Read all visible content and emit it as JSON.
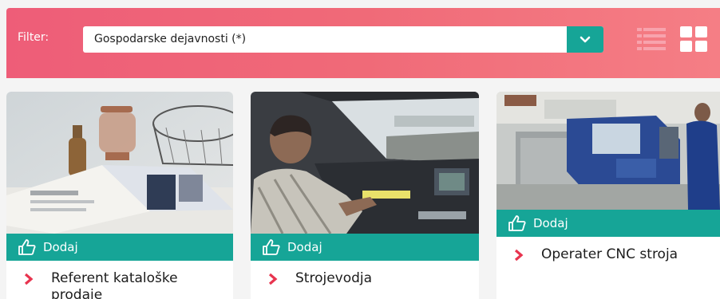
{
  "filter": {
    "label": "Filter:",
    "selected_value": "Gospodarske dejavnosti (*)",
    "toggle_icon": "chevron-down-icon"
  },
  "view_options": [
    {
      "icon": "list-view-icon",
      "active": false
    },
    {
      "icon": "grid-view-icon",
      "active": true
    }
  ],
  "cards": [
    {
      "image": "magazine-on-table-photo",
      "add_label": "Dodaj",
      "title": "Referent kataloške prodaje"
    },
    {
      "image": "train-driver-cab-photo",
      "add_label": "Dodaj",
      "title": "Strojevodja"
    },
    {
      "image": "cnc-machine-operator-photo",
      "add_label": "Dodaj",
      "title": "Operater CNC stroja"
    }
  ],
  "colors": {
    "header_gradient_start": "#ee5d78",
    "header_gradient_end": "#f57e85",
    "accent_teal": "#16a597",
    "chevron_red": "#e8344f"
  }
}
